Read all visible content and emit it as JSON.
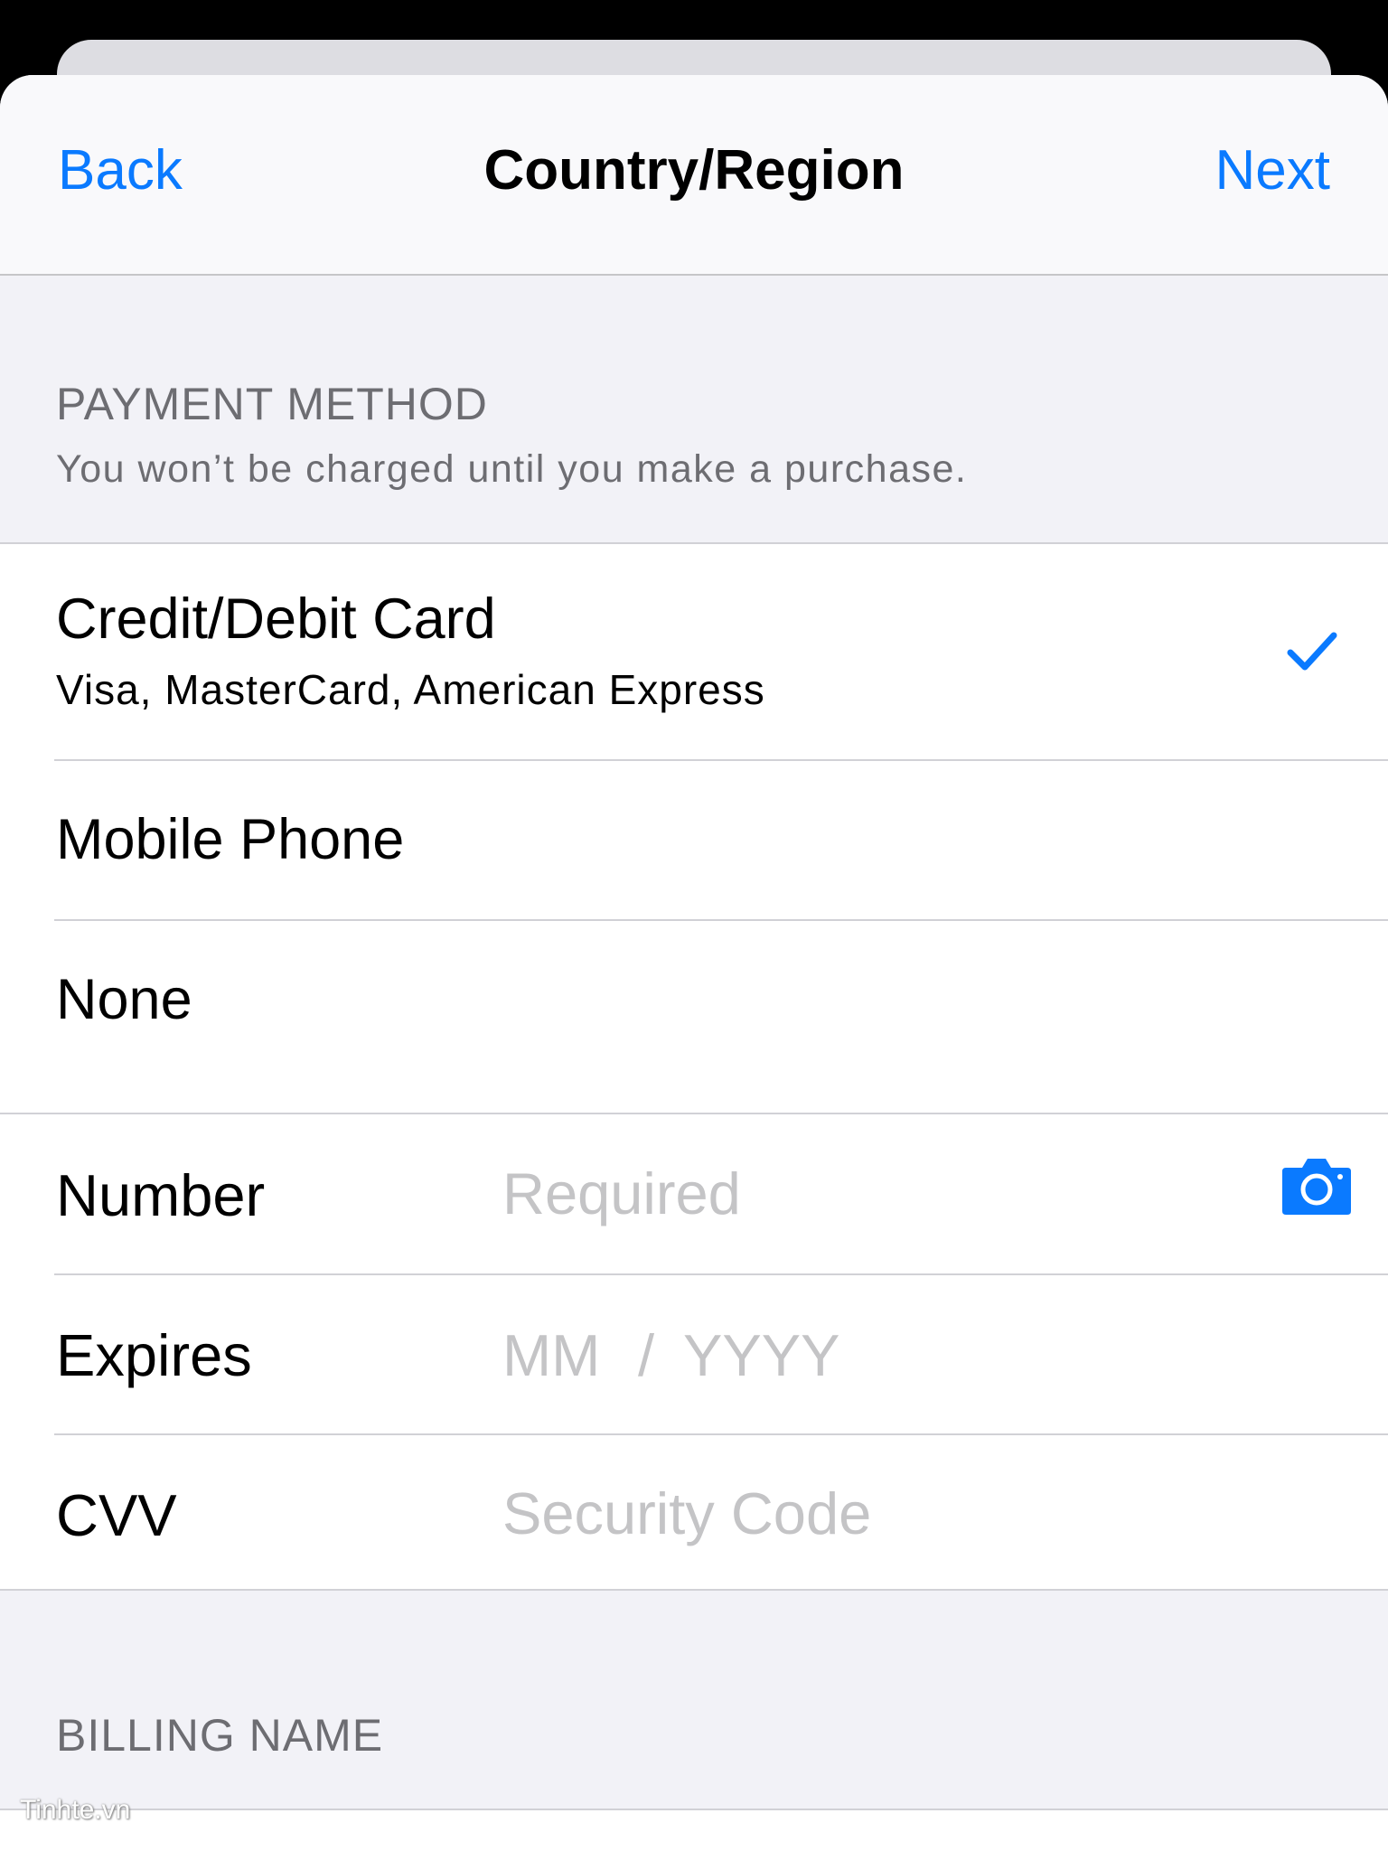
{
  "nav": {
    "back_label": "Back",
    "title": "Country/Region",
    "next_label": "Next",
    "accent_color": "#0a7aff"
  },
  "payment_method": {
    "header": "PAYMENT METHOD",
    "subheader": "You won’t be charged until you make a purchase.",
    "options": [
      {
        "title": "Credit/Debit Card",
        "subtitle": "Visa, MasterCard, American Express",
        "selected": true
      },
      {
        "title": "Mobile Phone",
        "selected": false
      },
      {
        "title": "None",
        "selected": false
      }
    ],
    "selected_icon": "checkmark-icon"
  },
  "card_fields": {
    "number": {
      "label": "Number",
      "placeholder": "Required",
      "icon": "camera-icon"
    },
    "expires": {
      "label": "Expires",
      "month_placeholder": "MM",
      "separator": "/",
      "year_placeholder": "YYYY"
    },
    "cvv": {
      "label": "CVV",
      "placeholder": "Security Code"
    }
  },
  "billing": {
    "header": "BILLING NAME"
  },
  "watermark": "Tinhte.vn"
}
